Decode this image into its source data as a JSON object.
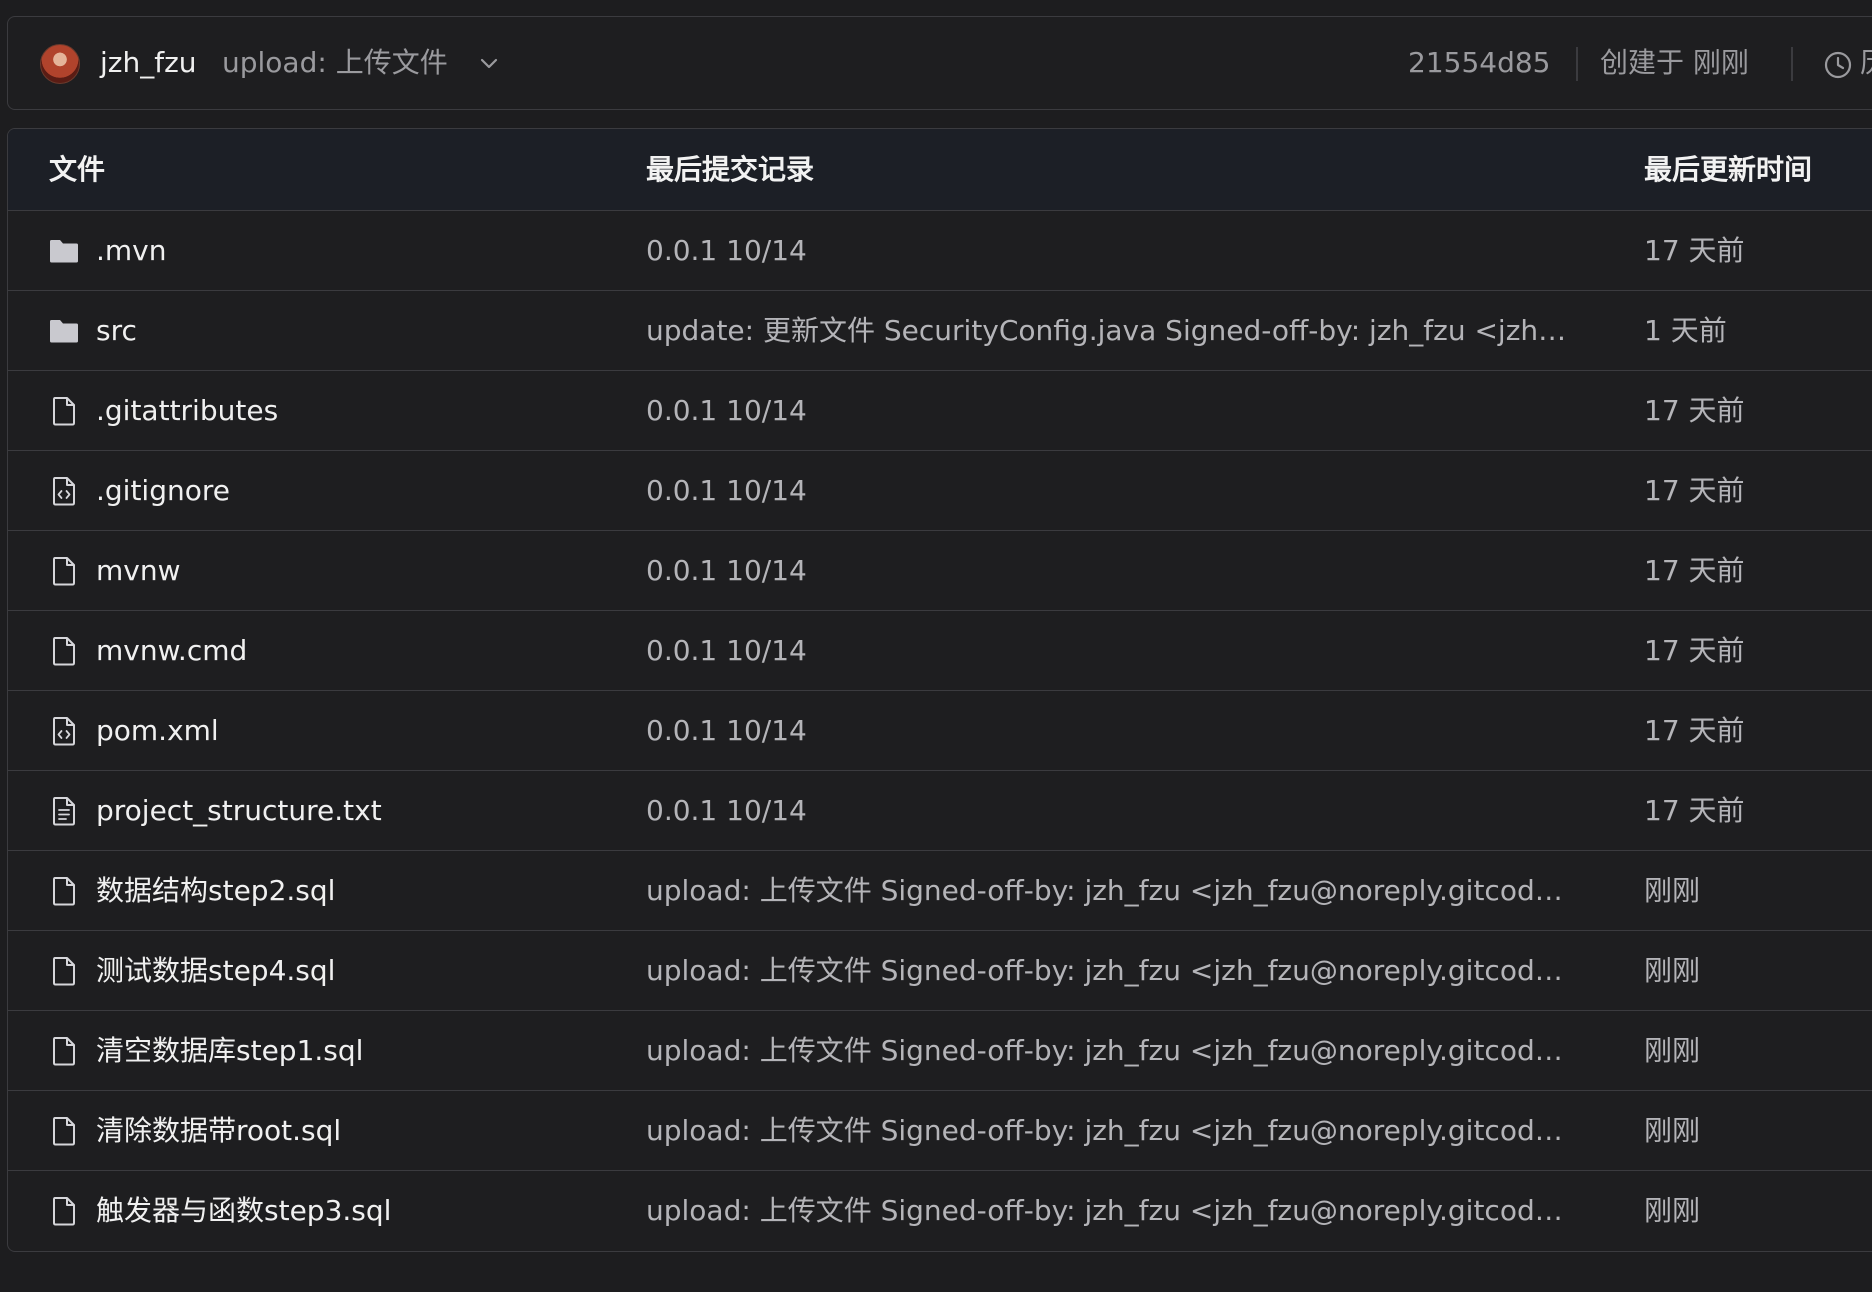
{
  "commit": {
    "author": "jzh_fzu",
    "message": "upload: 上传文件",
    "hash": "21554d85",
    "created": "创建于 刚刚",
    "history_label": "历"
  },
  "table": {
    "headers": {
      "file": "文件",
      "last_commit": "最后提交记录",
      "last_updated": "最后更新时间"
    },
    "rows": [
      {
        "icon": "folder-icon",
        "name": ".mvn",
        "message": "0.0.1 10/14",
        "time": "17 天前"
      },
      {
        "icon": "folder-icon",
        "name": "src",
        "message": "update: 更新文件 SecurityConfig.java Signed-off-by: jzh_fzu <jzh_f...",
        "time": "1 天前"
      },
      {
        "icon": "file-icon",
        "name": ".gitattributes",
        "message": "0.0.1 10/14",
        "time": "17 天前"
      },
      {
        "icon": "code-file-icon",
        "name": ".gitignore",
        "message": "0.0.1 10/14",
        "time": "17 天前"
      },
      {
        "icon": "file-icon",
        "name": "mvnw",
        "message": "0.0.1 10/14",
        "time": "17 天前"
      },
      {
        "icon": "file-icon",
        "name": "mvnw.cmd",
        "message": "0.0.1 10/14",
        "time": "17 天前"
      },
      {
        "icon": "code-file-icon",
        "name": "pom.xml",
        "message": "0.0.1 10/14",
        "time": "17 天前"
      },
      {
        "icon": "text-file-icon",
        "name": "project_structure.txt",
        "message": "0.0.1 10/14",
        "time": "17 天前"
      },
      {
        "icon": "file-icon",
        "name": "数据结构step2.sql",
        "message": "upload: 上传文件 Signed-off-by: jzh_fzu <jzh_fzu@noreply.gitcode.c...",
        "time": "刚刚"
      },
      {
        "icon": "file-icon",
        "name": "测试数据step4.sql",
        "message": "upload: 上传文件 Signed-off-by: jzh_fzu <jzh_fzu@noreply.gitcode.c...",
        "time": "刚刚"
      },
      {
        "icon": "file-icon",
        "name": "清空数据库step1.sql",
        "message": "upload: 上传文件 Signed-off-by: jzh_fzu <jzh_fzu@noreply.gitcode.c...",
        "time": "刚刚"
      },
      {
        "icon": "file-icon",
        "name": "清除数据带root.sql",
        "message": "upload: 上传文件 Signed-off-by: jzh_fzu <jzh_fzu@noreply.gitcode.c...",
        "time": "刚刚"
      },
      {
        "icon": "file-icon",
        "name": "触发器与函数step3.sql",
        "message": "upload: 上传文件 Signed-off-by: jzh_fzu <jzh_fzu@noreply.gitcode.c...",
        "time": "刚刚"
      }
    ]
  },
  "colors": {
    "background": "#1d1d1f",
    "header_background": "#1c1f26",
    "border": "#3b3b3f",
    "folder": "#c9c9cf",
    "muted_text": "#9a9a9e"
  }
}
